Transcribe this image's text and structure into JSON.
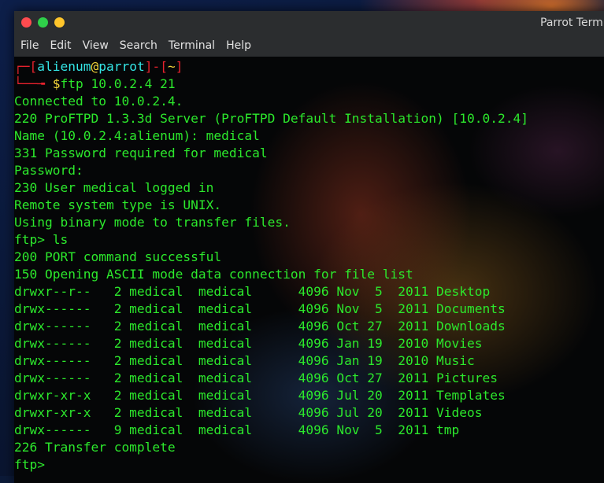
{
  "window": {
    "title": "Parrot Term"
  },
  "menu": [
    "File",
    "Edit",
    "View",
    "Search",
    "Terminal",
    "Help"
  ],
  "prompt": {
    "open_bracket": "[",
    "user": "alienum",
    "at": "@",
    "host": "parrot",
    "separator": "]-[",
    "dir": "~",
    "close_bracket": "]",
    "dollar": "$",
    "command": "ftp 10.0.2.4 21"
  },
  "output": [
    "Connected to 10.0.2.4.",
    "220 ProFTPD 1.3.3d Server (ProFTPD Default Installation) [10.0.2.4]",
    "Name (10.0.2.4:alienum): medical",
    "331 Password required for medical",
    "Password:",
    "230 User medical logged in",
    "Remote system type is UNIX.",
    "Using binary mode to transfer files.",
    "ftp> ls",
    "200 PORT command successful",
    "150 Opening ASCII mode data connection for file list",
    "drwxr--r--   2 medical  medical      4096 Nov  5  2011 Desktop",
    "drwx------   2 medical  medical      4096 Nov  5  2011 Documents",
    "drwx------   2 medical  medical      4096 Oct 27  2011 Downloads",
    "drwx------   2 medical  medical      4096 Jan 19  2010 Movies",
    "drwx------   2 medical  medical      4096 Jan 19  2010 Music",
    "drwx------   2 medical  medical      4096 Oct 27  2011 Pictures",
    "drwxr-xr-x   2 medical  medical      4096 Jul 20  2011 Templates",
    "drwxr-xr-x   2 medical  medical      4096 Jul 20  2011 Videos",
    "drwx------   9 medical  medical      4096 Nov  5  2011 tmp",
    "226 Transfer complete",
    "ftp>"
  ],
  "colors": {
    "text": "#2ce82c",
    "prompt_frame": "#e7222d",
    "prompt_user": "#34e6e6",
    "prompt_accent": "#f2d43a"
  }
}
